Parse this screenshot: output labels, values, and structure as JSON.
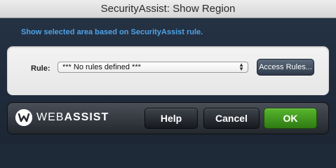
{
  "window": {
    "title": "SecurityAssist: Show Region"
  },
  "header": {
    "description": "Show selected area based on SecurityAssist rule."
  },
  "rule": {
    "label": "Rule:",
    "selected_value": "*** No rules defined ***",
    "access_rules_label": "Access Rules..."
  },
  "footer": {
    "logo_light": "WEB",
    "logo_bold": "ASSIST",
    "help_label": "Help",
    "cancel_label": "Cancel",
    "ok_label": "OK"
  },
  "colors": {
    "accent_text": "#4fa3e6",
    "ok_green": "#3f9a1e",
    "panel_bg": "#1e2937"
  },
  "icons": {
    "logo": "webassist-logo-icon",
    "select_arrows": "updown-arrows-icon"
  }
}
